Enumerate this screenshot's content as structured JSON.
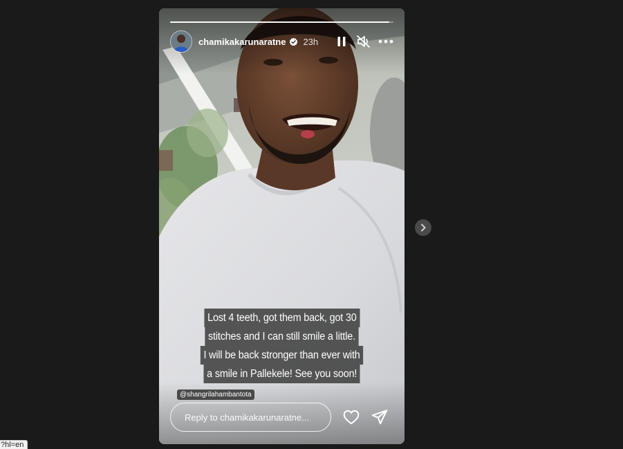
{
  "story": {
    "username": "chamikakarunaratne",
    "timestamp": "23h",
    "progress": 0.98,
    "caption_lines": [
      "Lost 4 teeth, got them back, got 30",
      "stitches and I can still smile a little.",
      "I will be back stronger than ever with",
      "a smile in Pallekele! See you soon!"
    ],
    "mention": "@shangrilahambantota",
    "reply_placeholder": "Reply to chamikakarunaratne...",
    "icons": {
      "verified": "verified-badge-icon",
      "pause": "pause-icon",
      "mute": "speaker-muted-icon",
      "more": "more-options-icon",
      "like": "heart-icon",
      "share": "paper-plane-icon",
      "next": "chevron-right-icon"
    },
    "colors": {
      "background": "#1a1a1a",
      "verified": "#ffffff",
      "caption_bg": "#3c3c3c"
    }
  },
  "statusbar": {
    "url": "?hl=en"
  }
}
